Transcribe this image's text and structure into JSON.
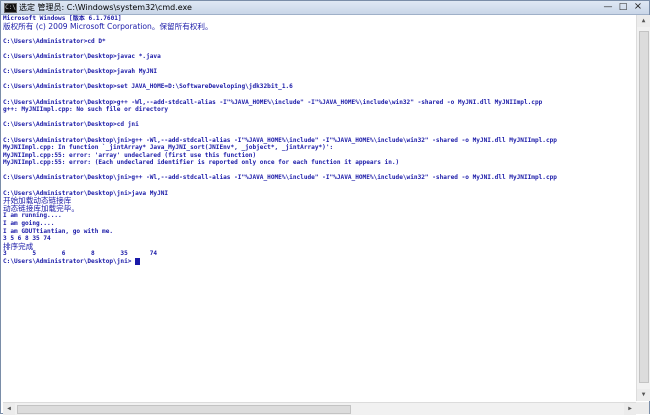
{
  "window": {
    "title": "选定 管理员: C:\\Windows\\system32\\cmd.exe",
    "minimize_glyph": "—",
    "maximize_glyph": "□",
    "close_glyph": "×",
    "icon": "cmd-icon"
  },
  "console": {
    "lines": [
      "Microsoft Windows [版本 6.1.7601]",
      "版权所有 (c) 2009 Microsoft Corporation。保留所有权利。",
      "",
      "C:\\Users\\Administrator>cd D*",
      "",
      "C:\\Users\\Administrator\\Desktop>javac *.java",
      "",
      "C:\\Users\\Administrator\\Desktop>javah MyJNI",
      "",
      "C:\\Users\\Administrator\\Desktop>set JAVA_HOME=D:\\SoftwareDeveloping\\jdk32bit_1.6",
      "",
      "C:\\Users\\Administrator\\Desktop>g++ -Wl,--add-stdcall-alias -I\"%JAVA_HOME%\\include\" -I\"%JAVA_HOME%\\include\\win32\" -shared -o MyJNI.dll MyJNIImpl.cpp",
      "g++: MyJNIImpl.cpp: No such file or directory",
      "",
      "C:\\Users\\Administrator\\Desktop>cd jni",
      "",
      "C:\\Users\\Administrator\\Desktop\\jni>g++ -Wl,--add-stdcall-alias -I\"%JAVA_HOME%\\include\" -I\"%JAVA_HOME%\\include\\win32\" -shared -o MyJNI.dll MyJNIImpl.cpp",
      "MyJNIImpl.cpp: In function `_jintArray* Java_MyJNI_sort(JNIEnv*, _jobject*, _jintArray*)':",
      "MyJNIImpl.cpp:55: error: 'array' undeclared (first use this function)",
      "MyJNIImpl.cpp:55: error: (Each undeclared identifier is reported only once for each function it appears in.)",
      "",
      "C:\\Users\\Administrator\\Desktop\\jni>g++ -Wl,--add-stdcall-alias -I\"%JAVA_HOME%\\include\" -I\"%JAVA_HOME%\\include\\win32\" -shared -o MyJNI.dll MyJNIImpl.cpp",
      "",
      "C:\\Users\\Administrator\\Desktop\\jni>java MyJNI",
      "开始加载动态链接库",
      "动态链接库加载完毕。",
      "I am running....",
      "I am going....",
      "I am GDUTtiantian, go with me.",
      "3 5 6 8 35 74",
      "排序完成",
      "3       5       6       8       35      74",
      "C:\\Users\\Administrator\\Desktop\\jni> "
    ]
  },
  "colors": {
    "text": "#1a1aa8",
    "background": "#ffffff",
    "titlebar": "#dfe8f4"
  }
}
